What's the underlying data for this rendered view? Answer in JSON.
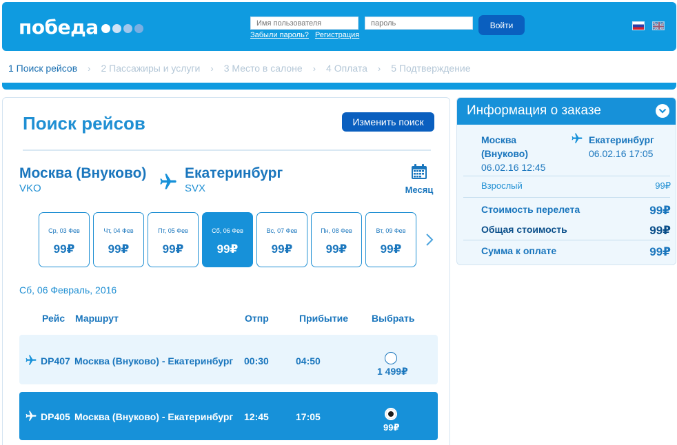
{
  "header": {
    "logo_text": "победа",
    "username_placeholder": "Имя пользователя",
    "password_placeholder": "пароль",
    "forgot_password": "Забыли пароль?",
    "register": "Регистрация",
    "login_button": "Войти",
    "languages": [
      "ru",
      "en"
    ]
  },
  "steps": [
    {
      "label": "1 Поиск рейсов",
      "active": true
    },
    {
      "label": "2 Пассажиры и услуги",
      "active": false
    },
    {
      "label": "3 Место в салоне",
      "active": false
    },
    {
      "label": "4 Оплата",
      "active": false
    },
    {
      "label": "5 Подтверждение",
      "active": false
    }
  ],
  "search": {
    "title": "Поиск рейсов",
    "change_button": "Изменить поиск",
    "from_city": "Москва (Внуково)",
    "from_code": "VKO",
    "to_city": "Екатеринбург",
    "to_code": "SVX",
    "month_label": "Месяц",
    "dates": [
      {
        "label": "Ср, 03 Фев",
        "price": "99₽",
        "selected": false
      },
      {
        "label": "Чт, 04 Фев",
        "price": "99₽",
        "selected": false
      },
      {
        "label": "Пт, 05 Фев",
        "price": "99₽",
        "selected": false
      },
      {
        "label": "Сб, 06 Фев",
        "price": "99₽",
        "selected": true
      },
      {
        "label": "Вс, 07 Фев",
        "price": "99₽",
        "selected": false
      },
      {
        "label": "Пн, 08 Фев",
        "price": "99₽",
        "selected": false
      },
      {
        "label": "Вт, 09 Фев",
        "price": "99₽",
        "selected": false
      }
    ],
    "selected_date": "Сб, 06 Февраль, 2016",
    "columns": {
      "flight": "Рейс",
      "route": "Маршрут",
      "departure": "Отпр",
      "arrival": "Прибытие",
      "select": "Выбрать"
    },
    "flights": [
      {
        "number": "DP407",
        "route": "Москва (Внуково) - Екатеринбург",
        "departure": "00:30",
        "arrival": "04:50",
        "price": "1 499₽",
        "selected": false
      },
      {
        "number": "DP405",
        "route": "Москва (Внуково) - Екатеринбург",
        "departure": "12:45",
        "arrival": "17:05",
        "price": "99₽",
        "selected": true
      }
    ]
  },
  "order": {
    "title": "Информация о заказе",
    "from_city_line1": "Москва",
    "from_city_line2": "(Внуково)",
    "from_datetime": "06.02.16 12:45",
    "to_city": "Екатеринбург",
    "to_datetime": "06.02.16 17:05",
    "passenger_label": "Взрослый",
    "passenger_price": "99₽",
    "flight_cost_label": "Стоимость перелета",
    "flight_cost_value": "99₽",
    "total_label": "Общая стоимость",
    "total_value": "99₽",
    "pay_label": "Сумма к оплате",
    "pay_value": "99₽"
  },
  "colors": {
    "brand_blue": "#0f9be0",
    "dark_blue": "#0a5fbf",
    "selected_blue": "#1791d9",
    "text_blue": "#1a76bd"
  }
}
